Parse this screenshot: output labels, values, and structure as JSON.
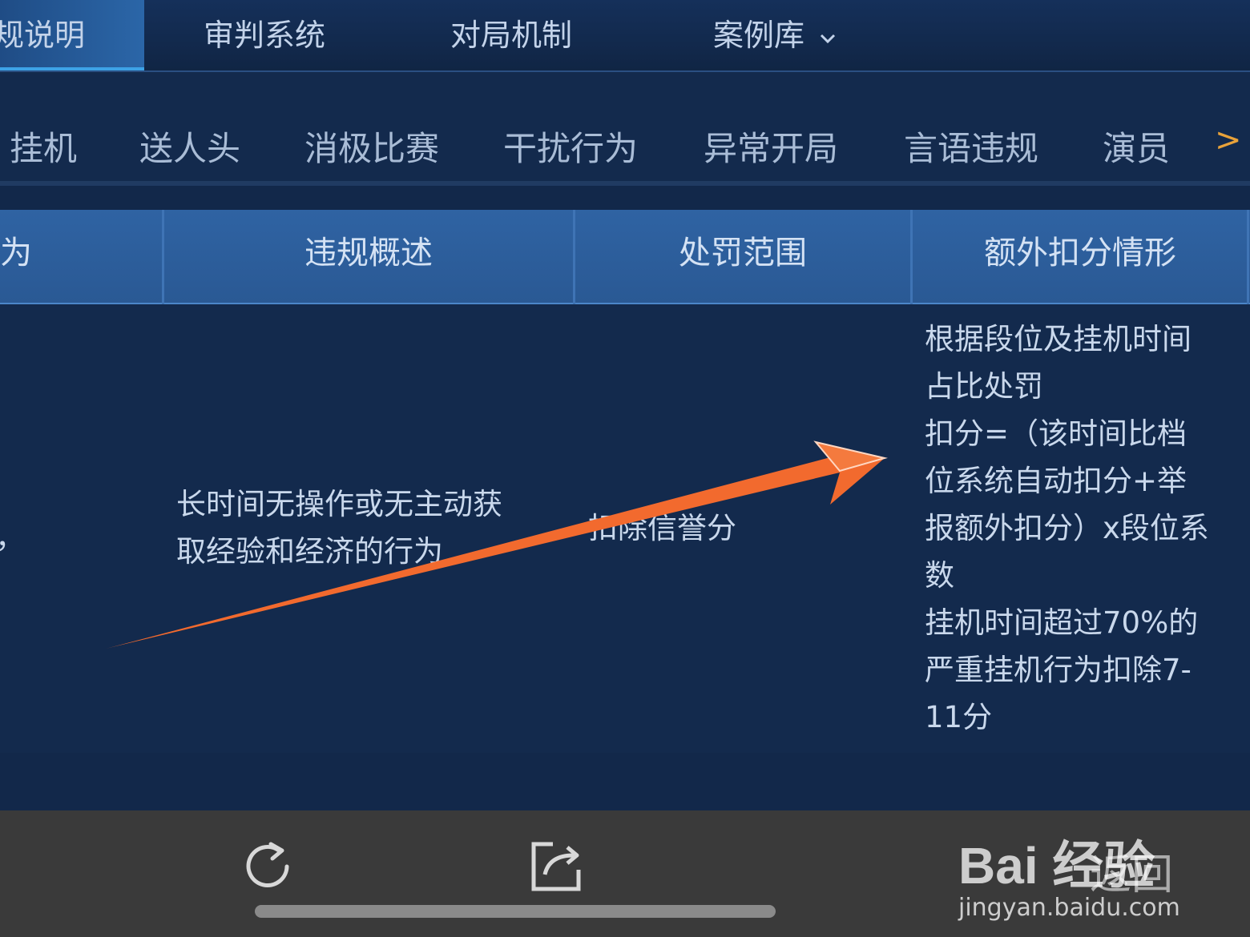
{
  "top_tabs": [
    {
      "label": "规说明",
      "active": true
    },
    {
      "label": "审判系统",
      "active": false
    },
    {
      "label": "对局机制",
      "active": false
    },
    {
      "label": "案例库",
      "active": false,
      "icon": "chevron-down-icon"
    }
  ],
  "categories": [
    "挂机",
    "送人头",
    "消极比赛",
    "干扰行为",
    "异常开局",
    "言语违规",
    "演员"
  ],
  "more_symbol": ">",
  "table": {
    "headers": [
      "为",
      "违规概述",
      "处罚范围",
      "额外扣分情形"
    ],
    "row": {
      "col0": "，",
      "description_line1": "长时间无操作或无主动获",
      "description_line2": "取经验和经济的行为",
      "penalty": "扣除信誉分",
      "extra_lines": [
        "根据段位及挂机时间",
        "占比处罚",
        "扣分=（该时间比档",
        "位系统自动扣分+举",
        "报额外扣分）x段位系",
        "数",
        "挂机时间超过70%的",
        "严重挂机行为扣除7-",
        "11分"
      ]
    }
  },
  "bottom_bar": {
    "refresh_icon": "refresh-icon",
    "share_icon": "share-icon",
    "back_label": "返回"
  },
  "watermark": {
    "main": "Bai 经验",
    "sub": "jingyan.baidu.com"
  },
  "colors": {
    "background": "#12284a",
    "header": "#2f63a3",
    "annotation_arrow": "#f26a2e",
    "more_symbol": "#e8a23a"
  }
}
